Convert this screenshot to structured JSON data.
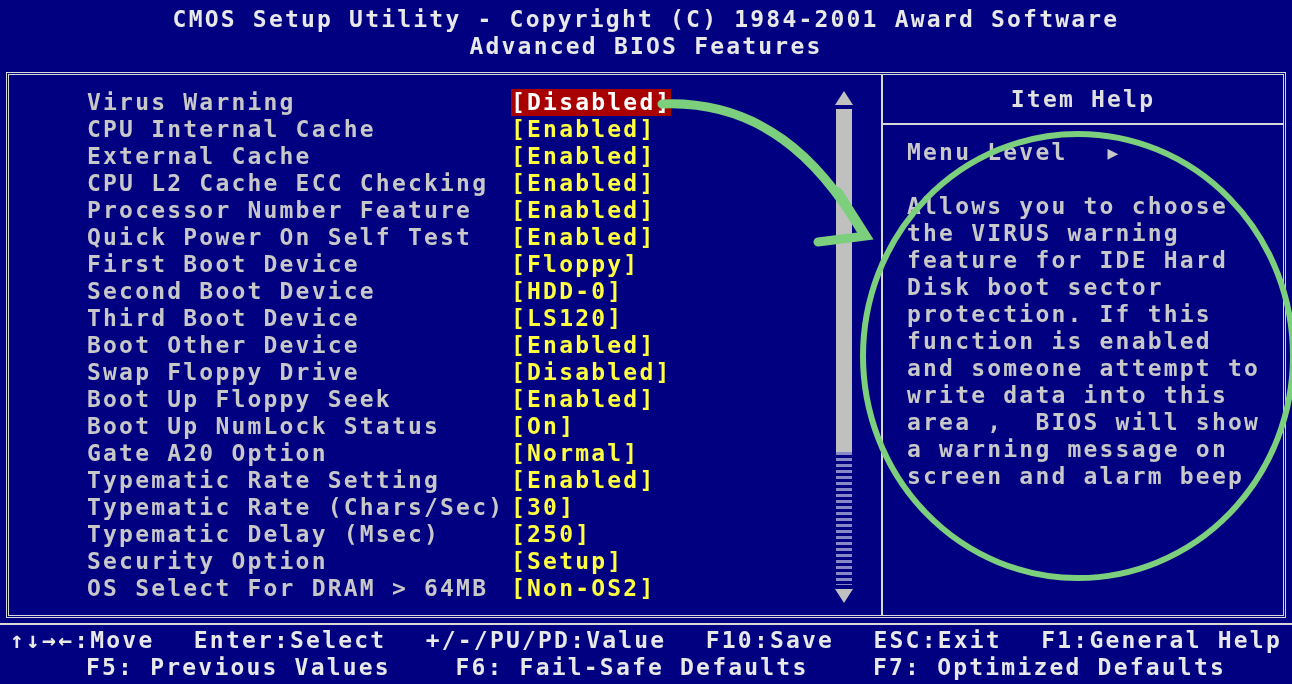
{
  "header": {
    "title": "CMOS Setup Utility - Copyright (C) 1984-2001 Award Software",
    "subtitle": "Advanced BIOS Features"
  },
  "settings": [
    {
      "label": "Virus Warning",
      "value": "[Disabled]",
      "selected": true
    },
    {
      "label": "CPU Internal Cache",
      "value": "[Enabled]",
      "selected": false
    },
    {
      "label": "External Cache",
      "value": "[Enabled]",
      "selected": false
    },
    {
      "label": "CPU L2 Cache ECC Checking",
      "value": "[Enabled]",
      "selected": false
    },
    {
      "label": "Processor Number Feature",
      "value": "[Enabled]",
      "selected": false
    },
    {
      "label": "Quick Power On Self Test",
      "value": "[Enabled]",
      "selected": false
    },
    {
      "label": "First Boot Device",
      "value": "[Floppy]",
      "selected": false
    },
    {
      "label": "Second Boot Device",
      "value": "[HDD-0]",
      "selected": false
    },
    {
      "label": "Third Boot Device",
      "value": "[LS120]",
      "selected": false
    },
    {
      "label": "Boot Other Device",
      "value": "[Enabled]",
      "selected": false
    },
    {
      "label": "Swap Floppy Drive",
      "value": "[Disabled]",
      "selected": false
    },
    {
      "label": "Boot Up Floppy Seek",
      "value": "[Enabled]",
      "selected": false
    },
    {
      "label": "Boot Up NumLock Status",
      "value": "[On]",
      "selected": false
    },
    {
      "label": "Gate A20 Option",
      "value": "[Normal]",
      "selected": false
    },
    {
      "label": "Typematic Rate Setting",
      "value": "[Enabled]",
      "selected": false
    },
    {
      "label": "Typematic Rate (Chars/Sec)",
      "value": "[30]",
      "selected": false
    },
    {
      "label": "Typematic Delay (Msec)",
      "value": "[250]",
      "selected": false
    },
    {
      "label": "Security Option",
      "value": "[Setup]",
      "selected": false
    },
    {
      "label": "OS Select For DRAM > 64MB",
      "value": "[Non-OS2]",
      "selected": false
    }
  ],
  "help": {
    "title": "Item Help",
    "menu_level": "Menu Level",
    "menu_level_marker": "▶",
    "text_lines": [
      "Allows you to choose",
      "the VIRUS warning",
      "feature for IDE Hard",
      "Disk boot sector",
      "protection. If this",
      "function is enabled",
      "and someone attempt to",
      "write data into this",
      "area ,  BIOS will show",
      "a warning message on",
      "screen and alarm beep"
    ]
  },
  "footer": [
    [
      "↑↓→←:Move",
      "Enter:Select",
      "+/-/PU/PD:Value",
      "F10:Save",
      "ESC:Exit",
      "F1:General Help"
    ],
    [
      "F5: Previous Values",
      "F6: Fail-Safe Defaults",
      "F7: Optimized Defaults"
    ]
  ]
}
